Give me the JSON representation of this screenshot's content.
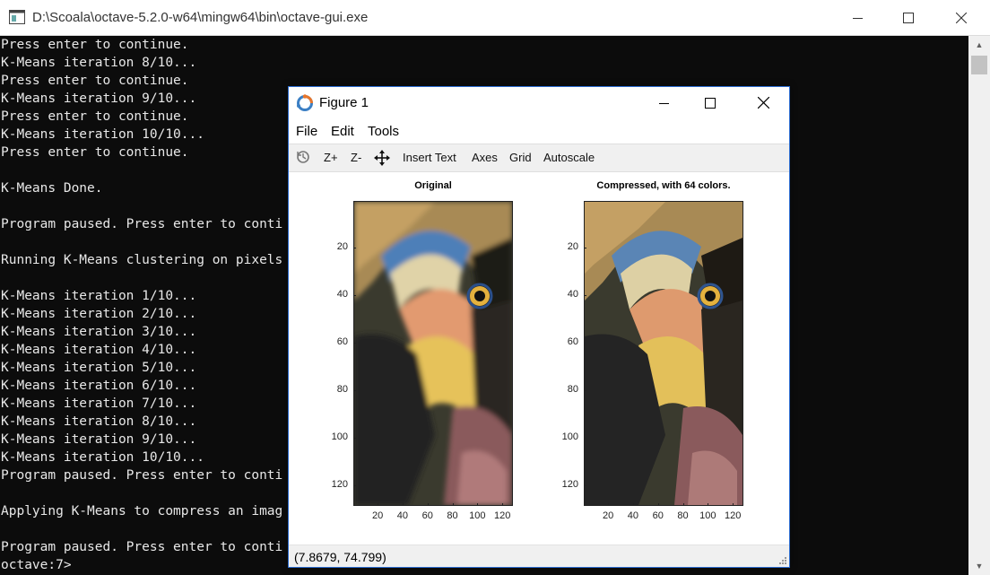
{
  "console": {
    "title": "D:\\Scoala\\octave-5.2.0-w64\\mingw64\\bin\\octave-gui.exe",
    "lines": [
      "Press enter to continue.",
      "K-Means iteration 8/10...",
      "Press enter to continue.",
      "K-Means iteration 9/10...",
      "Press enter to continue.",
      "K-Means iteration 10/10...",
      "Press enter to continue.",
      "",
      "K-Means Done.",
      "",
      "Program paused. Press enter to conti",
      "",
      "Running K-Means clustering on pixels",
      "",
      "K-Means iteration 1/10...",
      "K-Means iteration 2/10...",
      "K-Means iteration 3/10...",
      "K-Means iteration 4/10...",
      "K-Means iteration 5/10...",
      "K-Means iteration 6/10...",
      "K-Means iteration 7/10...",
      "K-Means iteration 8/10...",
      "K-Means iteration 9/10...",
      "K-Means iteration 10/10...",
      "Program paused. Press enter to conti",
      "",
      "Applying K-Means to compress an imag",
      "",
      "Program paused. Press enter to conti",
      "octave:7>"
    ]
  },
  "figure": {
    "title": "Figure 1",
    "menu": [
      "File",
      "Edit",
      "Tools"
    ],
    "toolbar": {
      "zoom_in": "Z+",
      "zoom_out": "Z-",
      "insert_text": "Insert Text",
      "axes": "Axes",
      "grid": "Grid",
      "autoscale": "Autoscale"
    },
    "status": "(7.8679, 74.799)",
    "axes": [
      {
        "title": "Original",
        "yticks": [
          "20",
          "40",
          "60",
          "80",
          "100",
          "120"
        ],
        "xticks": [
          "20",
          "40",
          "60",
          "80",
          "100",
          "120"
        ]
      },
      {
        "title": "Compressed, with 64 colors.",
        "yticks": [
          "20",
          "40",
          "60",
          "80",
          "100",
          "120"
        ],
        "xticks": [
          "20",
          "40",
          "60",
          "80",
          "100",
          "120"
        ]
      }
    ]
  }
}
